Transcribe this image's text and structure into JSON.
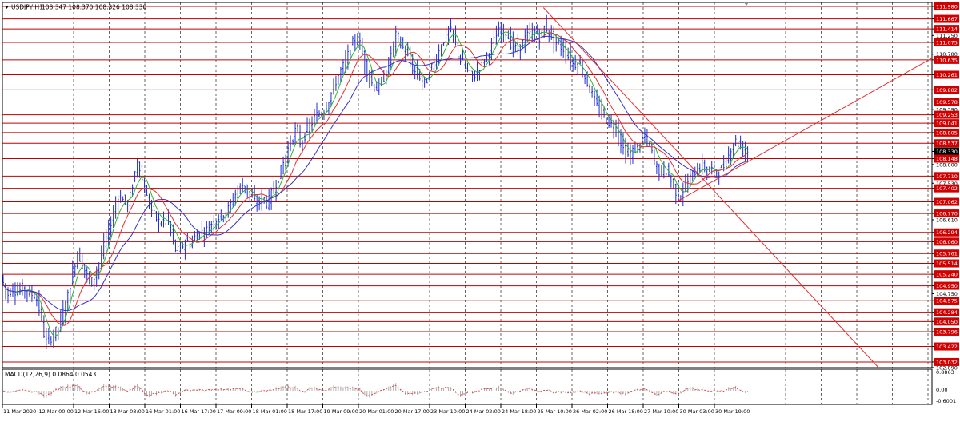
{
  "header": {
    "symbol_label": "USDJPY,H1",
    "ohlc": "108.347 108.370 108.326 108.330",
    "dropdown_icon": "triangle-down-icon"
  },
  "indicator": {
    "label": "MACD(12,26,9) 0.0864 0.0543",
    "axis_labels": [
      "0.8863",
      "0.00",
      "-0.6001"
    ]
  },
  "colors": {
    "background": "#ffffff",
    "grid": "#000000",
    "hline": "#c00000",
    "trendline": "#e03030",
    "candles": "#1c2fcf",
    "ma_fast": "#2bb52b",
    "ma_mid": "#e03030",
    "ma_slow": "#3333cc",
    "macd_hist": "#b0b0b0",
    "macd_signal": "#e03030",
    "price_badge_bg": "#d00000",
    "price_badge_text": "#ffffff",
    "current_badge_bg": "#000000"
  },
  "chart_data": {
    "type": "candlestick",
    "symbol": "USDJPY",
    "timeframe": "H1",
    "ylim": [
      102.89,
      111.98
    ],
    "price_axis_labels": [
      "111.980",
      "111.667",
      "111.414",
      "111.250",
      "111.075",
      "110.780",
      "110.635",
      "110.261",
      "109.882",
      "109.578",
      "109.390",
      "109.253",
      "109.041",
      "108.805",
      "108.537",
      "108.330",
      "108.148",
      "108.000",
      "107.710",
      "107.530",
      "107.402",
      "107.062",
      "106.770",
      "106.610",
      "106.294",
      "106.060",
      "105.761",
      "105.514",
      "105.240",
      "104.950",
      "104.750",
      "104.575",
      "104.284",
      "104.050",
      "103.796",
      "103.422",
      "103.032",
      "102.890"
    ],
    "horizontal_levels": [
      111.98,
      111.667,
      111.414,
      111.075,
      110.635,
      110.261,
      109.882,
      109.578,
      109.253,
      109.041,
      108.805,
      108.537,
      108.148,
      107.71,
      107.402,
      107.062,
      106.77,
      106.294,
      106.06,
      105.761,
      105.514,
      105.24,
      104.95,
      104.575,
      104.284,
      104.05,
      103.796,
      103.422,
      103.032
    ],
    "current_price": 108.33,
    "time_labels": [
      "11 Mar 2020",
      "12 Mar 00:00",
      "12 Mar 16:00",
      "13 Mar 08:00",
      "16 Mar 01:00",
      "16 Mar 17:00",
      "17 Mar 09:00",
      "18 Mar 01:00",
      "18 Mar 17:00",
      "19 Mar 09:00",
      "20 Mar 01:00",
      "20 Mar 17:00",
      "23 Mar 10:00",
      "24 Mar 02:00",
      "24 Mar 18:00",
      "25 Mar 10:00",
      "26 Mar 02:00",
      "26 Mar 18:00",
      "27 Mar 10:00",
      "30 Mar 03:00",
      "30 Mar 19:00"
    ],
    "price_path": [
      [
        0,
        105.2
      ],
      [
        8,
        104.7
      ],
      [
        14,
        104.9
      ],
      [
        20,
        104.8
      ],
      [
        28,
        104.9
      ],
      [
        36,
        104.75
      ],
      [
        44,
        104.7
      ],
      [
        50,
        104.2
      ],
      [
        56,
        103.5
      ],
      [
        60,
        103.6
      ],
      [
        66,
        103.7
      ],
      [
        72,
        103.9
      ],
      [
        78,
        104.3
      ],
      [
        84,
        104.7
      ],
      [
        90,
        105.3
      ],
      [
        96,
        105.8
      ],
      [
        100,
        105.6
      ],
      [
        106,
        105.3
      ],
      [
        112,
        105.0
      ],
      [
        118,
        105.2
      ],
      [
        124,
        105.6
      ],
      [
        130,
        106.0
      ],
      [
        136,
        106.4
      ],
      [
        142,
        106.9
      ],
      [
        148,
        107.2
      ],
      [
        154,
        107.1
      ],
      [
        160,
        107.0
      ],
      [
        166,
        107.6
      ],
      [
        172,
        108.2
      ],
      [
        178,
        107.5
      ],
      [
        184,
        107.1
      ],
      [
        190,
        106.8
      ],
      [
        196,
        106.6
      ],
      [
        202,
        106.5
      ],
      [
        208,
        106.7
      ],
      [
        214,
        106.2
      ],
      [
        220,
        105.8
      ],
      [
        226,
        105.9
      ],
      [
        232,
        106.1
      ],
      [
        238,
        106.0
      ],
      [
        244,
        106.2
      ],
      [
        250,
        106.3
      ],
      [
        256,
        106.3
      ],
      [
        262,
        106.5
      ],
      [
        268,
        106.6
      ],
      [
        274,
        106.7
      ],
      [
        280,
        106.8
      ],
      [
        286,
        106.9
      ],
      [
        292,
        107.2
      ],
      [
        298,
        107.4
      ],
      [
        304,
        107.5
      ],
      [
        310,
        107.3
      ],
      [
        316,
        107.1
      ],
      [
        322,
        107.0
      ],
      [
        328,
        107.2
      ],
      [
        334,
        107.0
      ],
      [
        340,
        107.3
      ],
      [
        346,
        107.6
      ],
      [
        352,
        107.9
      ],
      [
        358,
        108.3
      ],
      [
        364,
        108.6
      ],
      [
        370,
        108.9
      ],
      [
        376,
        108.5
      ],
      [
        382,
        108.8
      ],
      [
        388,
        109.0
      ],
      [
        394,
        109.2
      ],
      [
        400,
        109.3
      ],
      [
        406,
        109.4
      ],
      [
        412,
        109.7
      ],
      [
        418,
        110.0
      ],
      [
        424,
        110.3
      ],
      [
        430,
        110.5
      ],
      [
        436,
        110.8
      ],
      [
        442,
        111.1
      ],
      [
        448,
        111.2
      ],
      [
        454,
        110.7
      ],
      [
        460,
        110.3
      ],
      [
        466,
        110.0
      ],
      [
        472,
        109.9
      ],
      [
        478,
        110.1
      ],
      [
        484,
        110.4
      ],
      [
        490,
        110.9
      ],
      [
        496,
        111.3
      ],
      [
        502,
        111.0
      ],
      [
        508,
        110.8
      ],
      [
        514,
        110.5
      ],
      [
        520,
        110.3
      ],
      [
        526,
        110.2
      ],
      [
        532,
        110.0
      ],
      [
        538,
        110.4
      ],
      [
        544,
        110.6
      ],
      [
        550,
        110.9
      ],
      [
        556,
        111.2
      ],
      [
        562,
        111.4
      ],
      [
        568,
        111.2
      ],
      [
        574,
        110.7
      ],
      [
        580,
        110.5
      ],
      [
        586,
        110.3
      ],
      [
        592,
        110.2
      ],
      [
        598,
        110.4
      ],
      [
        604,
        110.6
      ],
      [
        610,
        110.8
      ],
      [
        616,
        111.0
      ],
      [
        622,
        111.3
      ],
      [
        628,
        111.4
      ],
      [
        634,
        111.3
      ],
      [
        640,
        111.0
      ],
      [
        646,
        110.9
      ],
      [
        652,
        111.0
      ],
      [
        658,
        111.2
      ],
      [
        664,
        111.3
      ],
      [
        670,
        111.35
      ],
      [
        676,
        111.2
      ],
      [
        682,
        111.5
      ],
      [
        688,
        111.3
      ],
      [
        694,
        111.1
      ],
      [
        700,
        111.0
      ],
      [
        706,
        110.9
      ],
      [
        712,
        110.7
      ],
      [
        718,
        110.5
      ],
      [
        724,
        110.6
      ],
      [
        730,
        110.3
      ],
      [
        736,
        110.0
      ],
      [
        742,
        109.7
      ],
      [
        748,
        109.4
      ],
      [
        754,
        109.3
      ],
      [
        760,
        109.1
      ],
      [
        766,
        109.0
      ],
      [
        772,
        108.9
      ],
      [
        778,
        108.5
      ],
      [
        784,
        108.2
      ],
      [
        790,
        108.3
      ],
      [
        796,
        108.4
      ],
      [
        802,
        108.6
      ],
      [
        808,
        108.7
      ],
      [
        814,
        108.4
      ],
      [
        820,
        108.0
      ],
      [
        826,
        107.8
      ],
      [
        832,
        107.9
      ],
      [
        838,
        107.7
      ],
      [
        844,
        107.4
      ],
      [
        850,
        107.2
      ],
      [
        856,
        107.4
      ],
      [
        862,
        107.6
      ],
      [
        868,
        107.8
      ],
      [
        874,
        107.9
      ],
      [
        880,
        108.0
      ],
      [
        886,
        107.8
      ],
      [
        892,
        107.9
      ],
      [
        898,
        107.8
      ],
      [
        904,
        107.9
      ],
      [
        910,
        108.1
      ],
      [
        916,
        108.5
      ],
      [
        922,
        108.6
      ],
      [
        928,
        108.4
      ],
      [
        934,
        108.33
      ]
    ],
    "x_index_range": [
      0,
      1165
    ]
  }
}
